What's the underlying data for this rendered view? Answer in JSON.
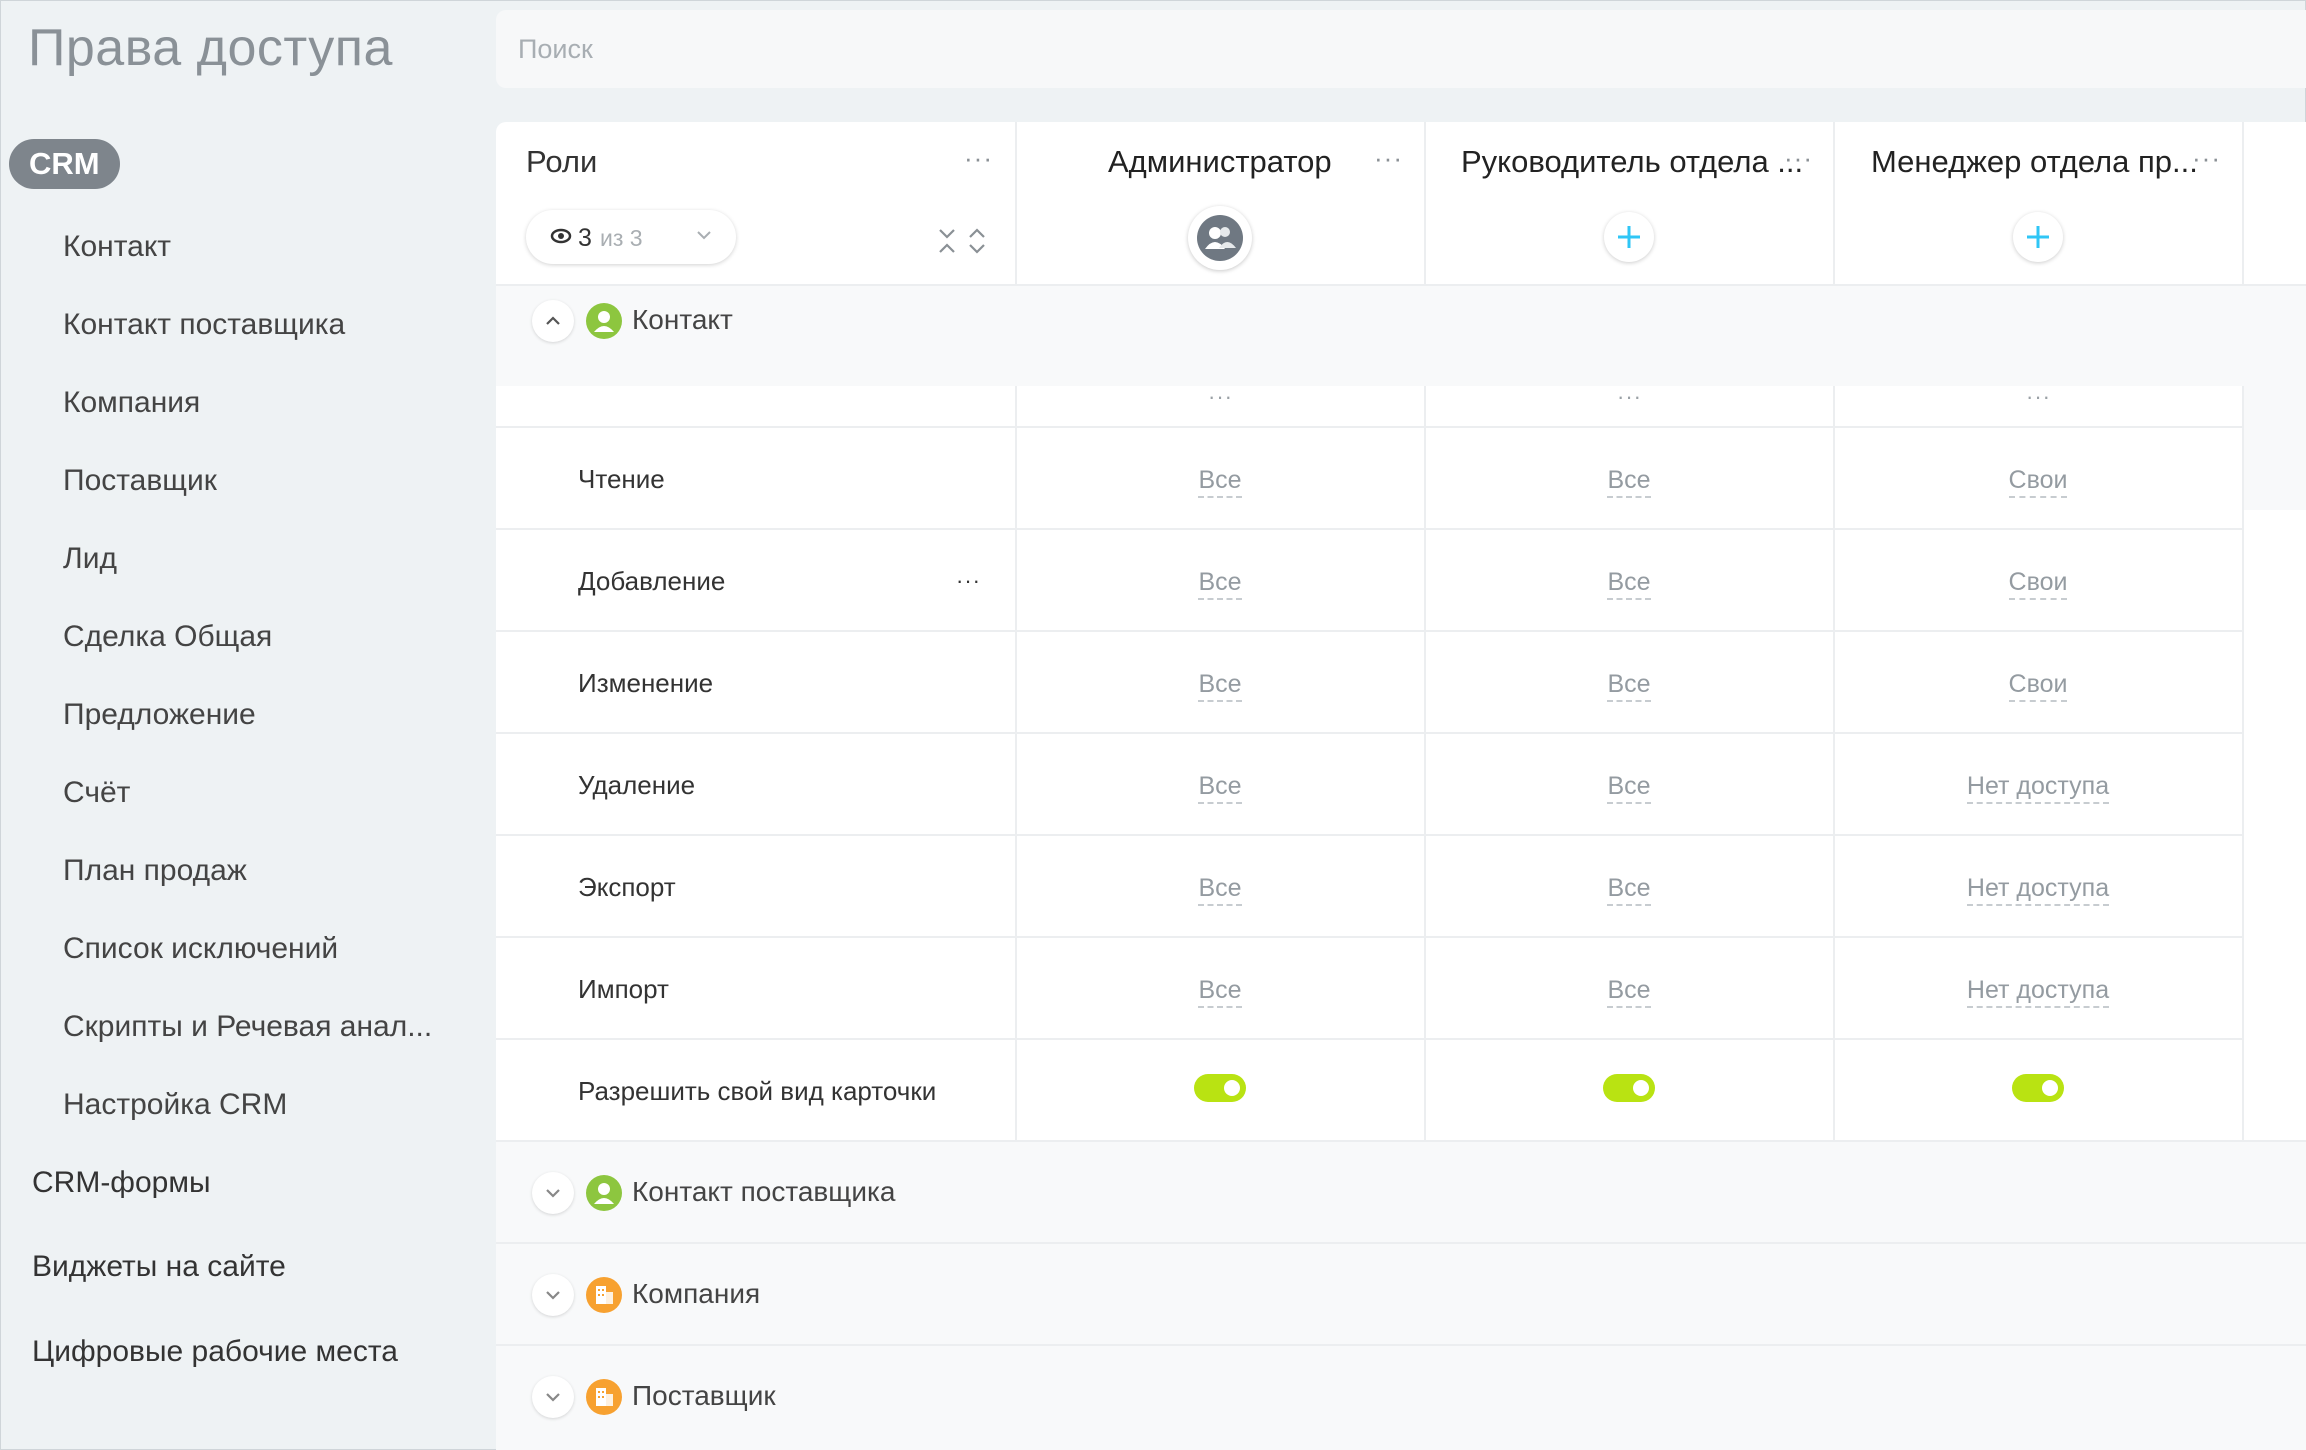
{
  "page": {
    "title": "Права доступа"
  },
  "search": {
    "placeholder": "Поиск",
    "value": ""
  },
  "sidebar": {
    "group_label": "CRM",
    "items": [
      "Контакт",
      "Контакт поставщика",
      "Компания",
      "Поставщик",
      "Лид",
      "Сделка Общая",
      "Предложение",
      "Счёт",
      "План продаж",
      "Список исключений",
      "Скрипты и Речевая анал...",
      "Настройка CRM"
    ],
    "top_items": [
      "CRM-формы",
      "Виджеты на сайте",
      "Цифровые рабочие места"
    ]
  },
  "matrix": {
    "roles_header": "Роли",
    "filter": {
      "count": "3",
      "of": "из 3"
    },
    "roles": [
      {
        "name": "Администратор"
      },
      {
        "name": "Руководитель отдела ..."
      },
      {
        "name": "Менеджер отдела пр..."
      }
    ],
    "open_section": {
      "title": "Контакт",
      "permissions": [
        {
          "label": "Чтение",
          "values": [
            "Все",
            "Все",
            "Свои"
          ]
        },
        {
          "label": "Добавление",
          "values": [
            "Все",
            "Все",
            "Свои"
          ]
        },
        {
          "label": "Изменение",
          "values": [
            "Все",
            "Все",
            "Свои"
          ]
        },
        {
          "label": "Удаление",
          "values": [
            "Все",
            "Все",
            "Нет доступа"
          ]
        },
        {
          "label": "Экспорт",
          "values": [
            "Все",
            "Все",
            "Нет доступа"
          ]
        },
        {
          "label": "Импорт",
          "values": [
            "Все",
            "Все",
            "Нет доступа"
          ]
        }
      ],
      "toggle_row": {
        "label": "Разрешить свой вид карточки",
        "values": [
          true,
          true,
          true
        ]
      }
    },
    "collapsed_sections": [
      {
        "title": "Контакт поставщика",
        "icon": "contact-icon",
        "color": "#8dc63f"
      },
      {
        "title": "Компания",
        "icon": "company-icon",
        "color": "#f7a130"
      },
      {
        "title": "Поставщик",
        "icon": "company-icon",
        "color": "#f7a130"
      }
    ]
  },
  "colors": {
    "accent": "#2fc6f6",
    "toggle_on": "#b9e312",
    "contact": "#8dc63f",
    "company": "#f7a130"
  }
}
